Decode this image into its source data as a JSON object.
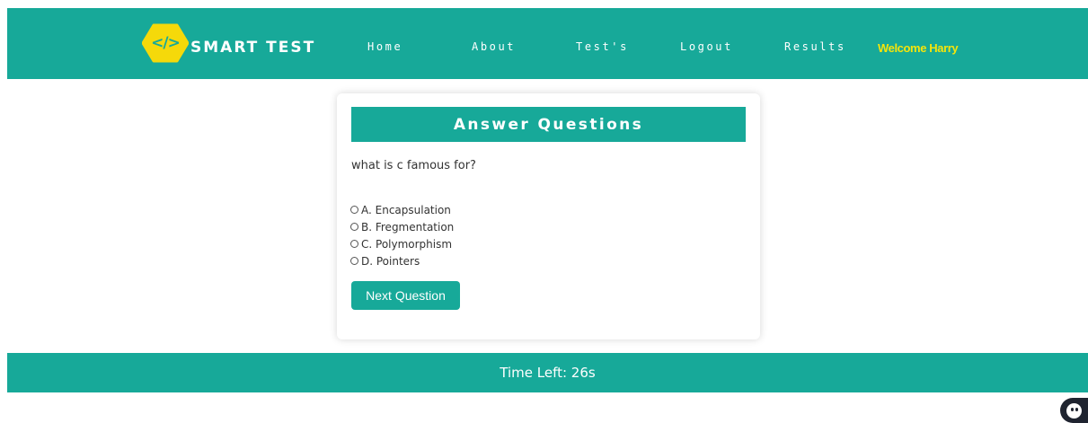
{
  "brand": {
    "logo_symbol": "</>",
    "name": "SMART TEST",
    "logo_color": "#f5d90a",
    "accent_color": "#17a999"
  },
  "nav": {
    "items": [
      {
        "label": "Home"
      },
      {
        "label": "About"
      },
      {
        "label": "Test's"
      },
      {
        "label": "Logout"
      },
      {
        "label": "Results"
      }
    ],
    "welcome": "Welcome Harry",
    "welcome_color": "#f5e50a"
  },
  "quiz": {
    "header": "Answer Questions",
    "question": "what is c famous for?",
    "options": [
      {
        "label": "A. Encapsulation"
      },
      {
        "label": "B. Fregmentation"
      },
      {
        "label": "C. Polymorphism"
      },
      {
        "label": "D. Pointers"
      }
    ],
    "next_label": "Next Question"
  },
  "timer": {
    "text": "Time Left: 26s"
  },
  "chat_widget": {
    "icon": "chat-bot-icon"
  }
}
